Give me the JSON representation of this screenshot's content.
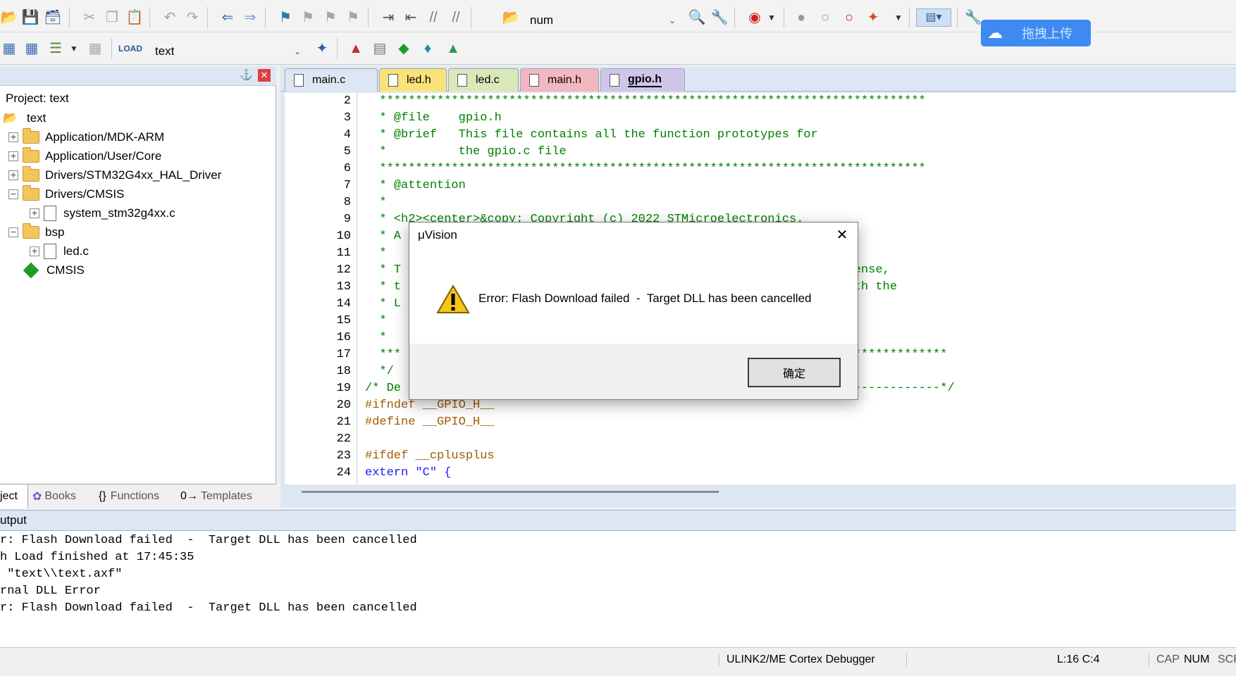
{
  "toolbar": {
    "target_combo": "num",
    "project_combo": "text"
  },
  "upload_widget": {
    "label": "拖拽上传"
  },
  "project_panel": {
    "header": "Project: text",
    "tree": [
      {
        "label": "text",
        "kind": "root"
      },
      {
        "label": "Application/MDK-ARM",
        "kind": "folder",
        "expander": "+"
      },
      {
        "label": "Application/User/Core",
        "kind": "folder",
        "expander": "+"
      },
      {
        "label": "Drivers/STM32G4xx_HAL_Driver",
        "kind": "folder",
        "expander": "+"
      },
      {
        "label": "Drivers/CMSIS",
        "kind": "folder",
        "expander": "−"
      },
      {
        "label": "system_stm32g4xx.c",
        "kind": "file",
        "expander": "+"
      },
      {
        "label": "bsp",
        "kind": "folder",
        "expander": "−"
      },
      {
        "label": "led.c",
        "kind": "file",
        "expander": "+"
      },
      {
        "label": "CMSIS",
        "kind": "component"
      }
    ],
    "bottom_tabs": [
      "ject",
      "Books",
      "Functions",
      "Templates"
    ]
  },
  "editor": {
    "tabs": [
      {
        "label": "main.c",
        "color": "#dde7f3"
      },
      {
        "label": "led.h",
        "color": "#f9e27a"
      },
      {
        "label": "led.c",
        "color": "#d8e8b8"
      },
      {
        "label": "main.h",
        "color": "#f2b7bf"
      },
      {
        "label": "gpio.h",
        "color": "#cfc6ea",
        "active": true
      }
    ],
    "lines": [
      {
        "n": "2",
        "text": "  ****************************************************************************",
        "color": "#008000"
      },
      {
        "n": "3",
        "text": "  * @file    gpio.h",
        "color": "#008000"
      },
      {
        "n": "4",
        "text": "  * @brief   This file contains all the function prototypes for",
        "color": "#008000"
      },
      {
        "n": "5",
        "text": "  *          the gpio.c file",
        "color": "#008000"
      },
      {
        "n": "6",
        "text": "  ****************************************************************************",
        "color": "#008000"
      },
      {
        "n": "7",
        "text": "  * @attention",
        "color": "#008000"
      },
      {
        "n": "8",
        "text": "  *",
        "color": "#008000"
      },
      {
        "n": "9",
        "text": "  * <h2><center>&copy; Copyright (c) 2022 STMicroelectronics.",
        "color": "#008000"
      },
      {
        "n": "10",
        "text": "  * A",
        "color": "#008000"
      },
      {
        "n": "11",
        "text": "  *",
        "color": "#008000"
      },
      {
        "n": "12",
        "text": "  * T                                                     Clause license,",
        "color": "#008000"
      },
      {
        "n": "13",
        "text": "  * t                                                     pliance with the",
        "color": "#008000"
      },
      {
        "n": "14",
        "text": "  * L",
        "color": "#008000"
      },
      {
        "n": "15",
        "text": "  *                                                       lause",
        "color": "#008000"
      },
      {
        "n": "16",
        "text": "  *",
        "color": "#008000"
      },
      {
        "n": "17",
        "text": "  ***                                                     ***********************",
        "color": "#008000"
      },
      {
        "n": "18",
        "text": "  */",
        "color": "#008000"
      },
      {
        "n": "19",
        "text": "/* De                                                      ---------------------*/",
        "color": "#008000"
      },
      {
        "n": "20",
        "text": "#ifndef __GPIO_H__",
        "color": "#a05a00"
      },
      {
        "n": "21",
        "text": "#define __GPIO_H__",
        "color": "#a05a00"
      },
      {
        "n": "22",
        "text": "",
        "color": "#000000"
      },
      {
        "n": "23",
        "text": "#ifdef __cplusplus",
        "color": "#a05a00"
      },
      {
        "n": "24",
        "text": "extern \"C\" {",
        "color": "#1a1aff"
      }
    ]
  },
  "output": {
    "title": "utput",
    "lines": [
      "r: Flash Download failed  -  Target DLL has been cancelled",
      "h Load finished at 17:45:35",
      " \"text\\\\text.axf\"",
      "rnal DLL Error",
      "r: Flash Download failed  -  Target DLL has been cancelled"
    ]
  },
  "status_bar": {
    "debugger": "ULINK2/ME Cortex Debugger",
    "position": "L:16 C:4",
    "cap": "CAP",
    "num": "NUM",
    "scrl": "SCR"
  },
  "dialog": {
    "title": "μVision",
    "message": "Error: Flash Download failed  -  Target DLL has been cancelled",
    "ok_label": "确定",
    "close_glyph": "✕"
  }
}
